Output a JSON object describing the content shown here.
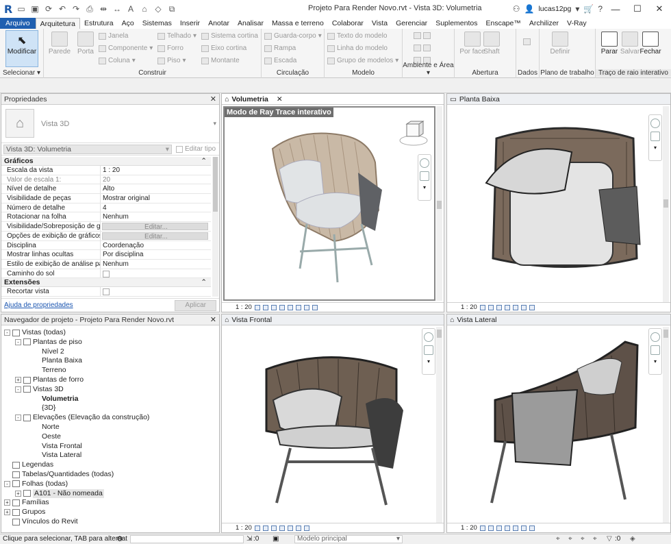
{
  "titlebar": {
    "window_title": "Projeto Para Render Novo.rvt - Vista 3D: Volumetria",
    "user": "lucas12pg"
  },
  "tabs": [
    "Arquivo",
    "Arquitetura",
    "Estrutura",
    "Aço",
    "Sistemas",
    "Inserir",
    "Anotar",
    "Analisar",
    "Massa e terreno",
    "Colaborar",
    "Vista",
    "Gerenciar",
    "Suplementos",
    "Enscape™",
    "Archilizer",
    "V-Ray"
  ],
  "ribbon": {
    "modificar": "Modificar",
    "selecionar": "Selecionar",
    "construir": {
      "label": "Construir",
      "parede": "Parede",
      "porta": "Porta",
      "janela": "Janela",
      "componente": "Componente",
      "coluna": "Coluna",
      "telhado": "Telhado",
      "forro": "Forro",
      "piso": "Piso",
      "sistema_cortina": "Sistema cortina",
      "eixo_cortina": "Eixo cortina",
      "montante": "Montante"
    },
    "circulacao": {
      "label": "Circulação",
      "guarda_corpo": "Guarda-corpo",
      "rampa": "Rampa",
      "escada": "Escada"
    },
    "modelo": {
      "label": "Modelo",
      "texto": "Texto do modelo",
      "linha": "Linha do modelo",
      "grupo": "Grupo de modelos"
    },
    "ambiente": {
      "label": "Ambiente e Área"
    },
    "abertura": {
      "label": "Abertura",
      "por_face": "Por face",
      "shaft": "Shaft"
    },
    "dados": {
      "label": "Dados"
    },
    "plano": {
      "label": "Plano de trabalho",
      "definir": "Definir"
    },
    "raio": {
      "label": "Traço de raio interativo",
      "parar": "Parar",
      "salvar": "Salvar",
      "fechar": "Fechar"
    }
  },
  "properties": {
    "title": "Propriedades",
    "type_name": "Vista 3D",
    "selector": "Vista 3D: Volumetria",
    "edit_type": "Editar tipo",
    "section_graficos": "Gráficos",
    "rows": [
      {
        "k": "Escala da vista",
        "v": "1 : 20"
      },
      {
        "k": "Valor de escala    1:",
        "v": "20",
        "grey": true
      },
      {
        "k": "Nível de detalhe",
        "v": "Alto"
      },
      {
        "k": "Visibilidade de peças",
        "v": "Mostrar original"
      },
      {
        "k": "Número de detalhe",
        "v": "4"
      },
      {
        "k": "Rotacionar na folha",
        "v": "Nenhum"
      },
      {
        "k": "Visibilidade/Sobreposição de grá...",
        "v": "Editar...",
        "btn": true
      },
      {
        "k": "Opções de exibição de gráficos",
        "v": "Editar...",
        "btn": true
      },
      {
        "k": "Disciplina",
        "v": "Coordenação"
      },
      {
        "k": "Mostrar linhas ocultas",
        "v": "Por disciplina"
      },
      {
        "k": "Estilo de exibição de análise pad...",
        "v": "Nenhum"
      },
      {
        "k": "Caminho do sol",
        "v": "",
        "cb": true
      }
    ],
    "section_extensoes": "Extensões",
    "recortar": "Recortar vista",
    "help_link": "Ajuda de propriedades",
    "apply": "Aplicar"
  },
  "navigator": {
    "title": "Navegador de projeto - Projeto Para Render Novo.rvt",
    "items": [
      {
        "label": "Vistas (todas)",
        "level": 0,
        "exp": "-"
      },
      {
        "label": "Plantas de piso",
        "level": 1,
        "exp": "-"
      },
      {
        "label": "Nível 2",
        "level": 2
      },
      {
        "label": "Planta Baixa",
        "level": 2
      },
      {
        "label": "Terreno",
        "level": 2
      },
      {
        "label": "Plantas de forro",
        "level": 1,
        "exp": "+"
      },
      {
        "label": "Vistas 3D",
        "level": 1,
        "exp": "-"
      },
      {
        "label": "Volumetria",
        "level": 2,
        "bold": true
      },
      {
        "label": "{3D}",
        "level": 2
      },
      {
        "label": "Elevações (Elevação da construção)",
        "level": 1,
        "exp": "-"
      },
      {
        "label": "Norte",
        "level": 2
      },
      {
        "label": "Oeste",
        "level": 2
      },
      {
        "label": "Vista Frontal",
        "level": 2
      },
      {
        "label": "Vista Lateral",
        "level": 2
      },
      {
        "label": "Legendas",
        "level": 0
      },
      {
        "label": "Tabelas/Quantidades (todas)",
        "level": 0
      },
      {
        "label": "Folhas (todas)",
        "level": 0,
        "exp": "-"
      },
      {
        "label": "A101 - Não nomeada",
        "level": 1,
        "exp": "+",
        "sel": true
      },
      {
        "label": "Famílias",
        "level": 0,
        "exp": "+"
      },
      {
        "label": "Grupos",
        "level": 0,
        "exp": "+"
      },
      {
        "label": "Vínculos do Revit",
        "level": 0
      }
    ]
  },
  "views": {
    "volumetria": {
      "title": "Volumetria",
      "banner": "Modo de Ray Trace interativo",
      "scale": "1 : 20"
    },
    "planta": {
      "title": "Planta Baixa",
      "scale": "1 : 20"
    },
    "frontal": {
      "title": "Vista Frontal",
      "scale": "1 : 20"
    },
    "lateral": {
      "title": "Vista Lateral",
      "scale": "1 : 20"
    }
  },
  "status": {
    "hint": "Clique para selecionar, TAB para alternat",
    "count": ":0",
    "model": "Modelo principal",
    "filter": ":0"
  }
}
